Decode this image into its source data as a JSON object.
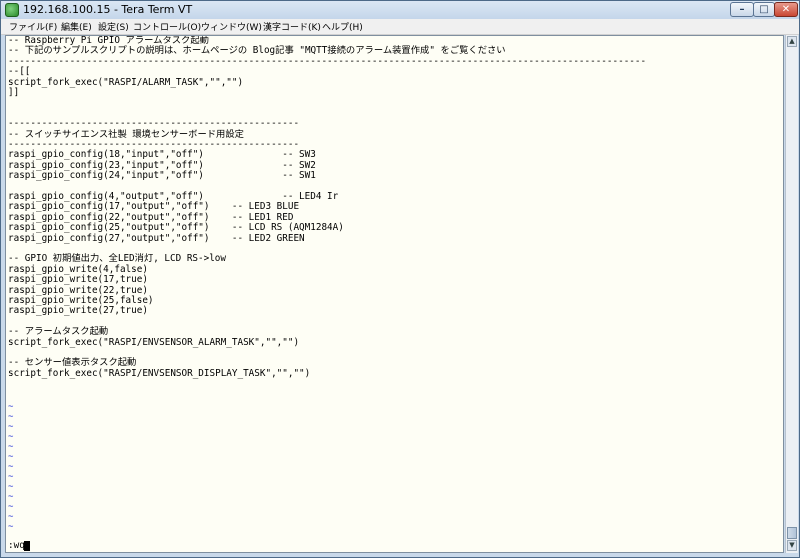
{
  "window": {
    "title": "192.168.100.15 - Tera Term VT"
  },
  "menu": [
    "ファイル(F)",
    "編集(E)",
    "設定(S)",
    "コントロール(O)",
    "ウィンドウ(W)",
    "漢字コード(K)",
    "ヘルプ(H)"
  ],
  "terminal": {
    "lines": [
      "-- Raspberry Pi GPIO アラームタスク起動",
      "-- 下記のサンプルスクリプトの説明は、ホームページの Blog記事 \"MQTT接続のアラーム装置作成\" をご覧ください",
      "------------------------------------------------------------------------------------------------------------------",
      "--[[",
      "script_fork_exec(\"RASPI/ALARM_TASK\",\"\",\"\")",
      "]]",
      "",
      "",
      "----------------------------------------------------",
      "-- スイッチサイエンス社製 環境センサーボード用設定",
      "----------------------------------------------------",
      "raspi_gpio_config(18,\"input\",\"off\")              -- SW3",
      "raspi_gpio_config(23,\"input\",\"off\")              -- SW2",
      "raspi_gpio_config(24,\"input\",\"off\")              -- SW1",
      "",
      "raspi_gpio_config(4,\"output\",\"off\")              -- LED4 Ir",
      "raspi_gpio_config(17,\"output\",\"off\")    -- LED3 BLUE",
      "raspi_gpio_config(22,\"output\",\"off\")    -- LED1 RED",
      "raspi_gpio_config(25,\"output\",\"off\")    -- LCD RS (AQM1284A)",
      "raspi_gpio_config(27,\"output\",\"off\")    -- LED2 GREEN",
      "",
      "-- GPIO 初期値出力、全LED消灯, LCD RS->low",
      "raspi_gpio_write(4,false)",
      "raspi_gpio_write(17,true)",
      "raspi_gpio_write(22,true)",
      "raspi_gpio_write(25,false)",
      "raspi_gpio_write(27,true)",
      "",
      "-- アラームタスク起動",
      "script_fork_exec(\"RASPI/ENVSENSOR_ALARM_TASK\",\"\",\"\")",
      "",
      "-- センサー値表示タスク起動",
      "script_fork_exec(\"RASPI/ENVSENSOR_DISPLAY_TASK\",\"\",\"\")"
    ],
    "tilde": "~",
    "command_line": ":wq"
  }
}
